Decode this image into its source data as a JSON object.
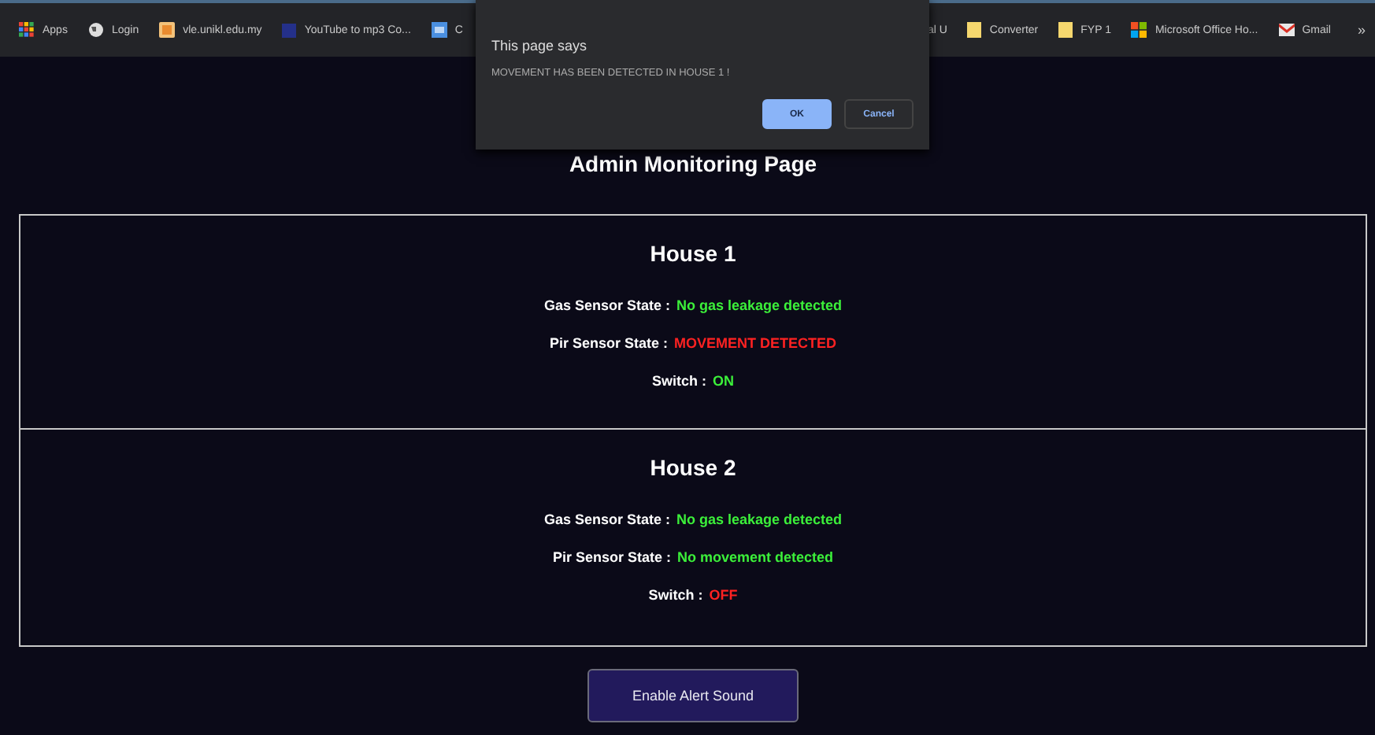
{
  "bookmarks_left": [
    {
      "kind": "apps",
      "label": "Apps"
    },
    {
      "kind": "globe",
      "label": "Login"
    },
    {
      "kind": "image",
      "label": "vle.unikl.edu.my"
    },
    {
      "kind": "video",
      "label": "YouTube to mp3 Co..."
    },
    {
      "kind": "bing",
      "label": "C"
    }
  ],
  "bookmarks_right": [
    {
      "kind": "none",
      "label": "al U"
    },
    {
      "kind": "folder",
      "label": "Converter"
    },
    {
      "kind": "folder",
      "label": "FYP 1"
    },
    {
      "kind": "office",
      "label": "Microsoft Office Ho..."
    },
    {
      "kind": "mail",
      "label": "Gmail"
    }
  ],
  "bookmarks_more": "»",
  "dialog": {
    "title": "This page says",
    "message": "MOVEMENT HAS BEEN DETECTED IN HOUSE 1 !",
    "buttons": [
      {
        "label": "OK",
        "primary": true
      },
      {
        "label": "Cancel",
        "primary": false
      }
    ]
  },
  "page_title": "Admin Monitoring Page",
  "houses": [
    {
      "name": "House 1",
      "rows": [
        {
          "label": "Gas Sensor State :",
          "value": "No gas leakage detected",
          "alert": false
        },
        {
          "label": "Pir Sensor State :",
          "value": "MOVEMENT DETECTED",
          "alert": true
        },
        {
          "label": "Switch :",
          "value": "ON",
          "alert": false
        }
      ]
    },
    {
      "name": "House 2",
      "rows": [
        {
          "label": "Gas Sensor State :",
          "value": "No gas leakage detected",
          "alert": false
        },
        {
          "label": "Pir Sensor State :",
          "value": "No movement detected",
          "alert": false
        },
        {
          "label": "Switch :",
          "value": "OFF",
          "alert": true
        }
      ]
    }
  ],
  "alert_button": "Enable Alert Sound"
}
